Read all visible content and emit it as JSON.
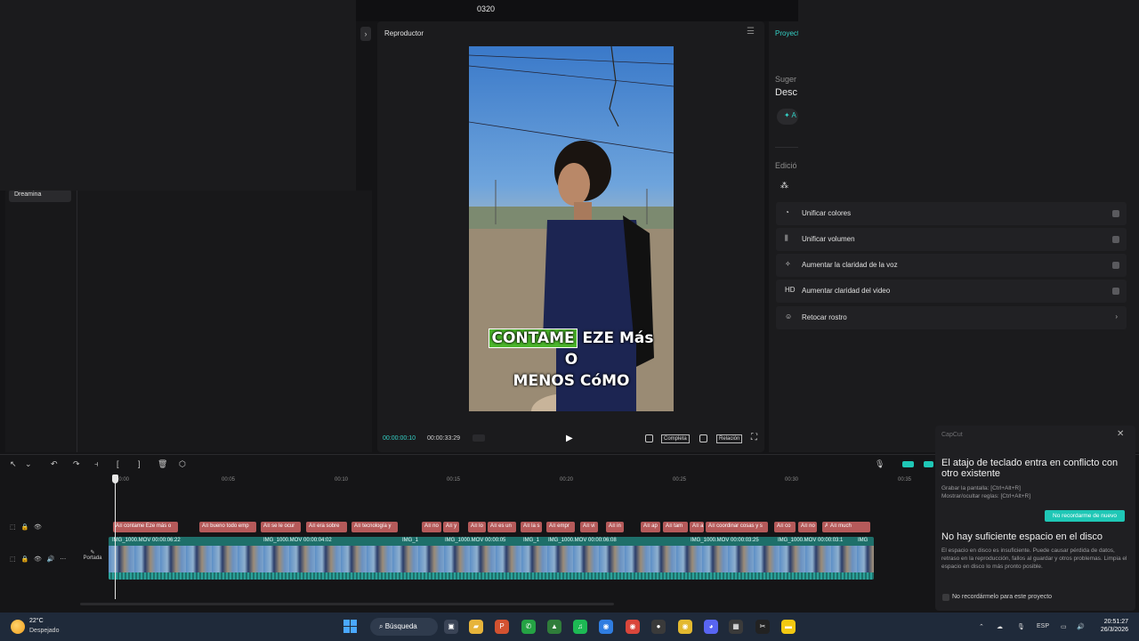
{
  "window": {
    "title": "0320"
  },
  "media_panel": {
    "dreamina_label": "Dreamina",
    "collapse_icon": "›"
  },
  "player": {
    "title": "Reproductor",
    "menu_icon": "☰",
    "caption_highlight": "CONTAME",
    "caption_rest_line1": " EZE Más",
    "caption_line2": "O",
    "caption_line3": "MENOS CóMO",
    "time_current": "00:00:00:10",
    "time_total": "00:00:33:29",
    "play_icon": "▶",
    "full_label": "Completa",
    "ratio_label": "Relación",
    "fullscreen_icon": "⛶"
  },
  "right_panel": {
    "project_tab": "Proyect",
    "suggestions": "Suger",
    "desc": "Desc",
    "spark_btn": "✦ A",
    "edicion": "Edició",
    "items": [
      {
        "icon": "◔",
        "label": "Unificar colores",
        "kind": "toggle"
      },
      {
        "icon": "⫼",
        "label": "Unificar volumen",
        "kind": "toggle"
      },
      {
        "icon": "✧",
        "label": "Aumentar la claridad de la voz",
        "kind": "toggle"
      },
      {
        "icon": "HD",
        "label": "Aumentar claridad del video",
        "kind": "toggle"
      },
      {
        "icon": "☺",
        "label": "Retocar rostro",
        "kind": "chevron"
      }
    ]
  },
  "timeline": {
    "toolbar_icons": [
      "↖",
      "⌄",
      "↶",
      "↷",
      "⫞",
      "[",
      "]",
      "🗑",
      "⬡"
    ],
    "ruler_labels": [
      "00:00",
      "00:05",
      "00:10",
      "00:15",
      "00:20",
      "00:25",
      "00:30",
      "00:35"
    ],
    "portada_label": "Portada",
    "text_clips": [
      "A≡ contame Eze más o",
      "A≡ bueno todo emp",
      "A≡ se le ocur",
      "A≡ era sobre",
      "A≡ tecnología y",
      "A≡ no",
      "A≡ y",
      "A≡ lo",
      "A≡ es un",
      "A≡ la s",
      "A≡ empr",
      "A≡ vi",
      "A≡ in",
      "A≡ ap",
      "A≡ tam",
      "A≡ a",
      "A≡ coordinar cosas y s",
      "A≡ co",
      "A≡ no",
      "A≡ mu",
      "A≡ much"
    ],
    "video_clips": [
      "IMG_1000.MOV  00:00:06:22",
      "IMG_1000.MOV  00:00:04:02",
      "IMG_1",
      "IMG_1000.MOV  00:00:05",
      "IMG_1",
      "IMG_1000.MOV  00:00:06:08",
      "IMG_1000.MOV  00:00:03:25",
      "IMG_1000.MOV  00:00:03:1",
      "IMG"
    ]
  },
  "notifications": {
    "app": "CapCut",
    "close_icon": "✕",
    "n1_title": "El atajo de teclado entra en conflicto con otro existente",
    "n1_line1": "Grabar la pantalla: [Ctrl+Alt+R]",
    "n1_line2": "Mostrar/ocultar reglas: [Ctrl+Alt+R]",
    "n1_button": "No recordarme de nuevo",
    "n2_title": "No hay suficiente espacio en el disco",
    "n2_body": "El espacio en disco es insuficiente. Puede causar pérdida de datos, retraso en la reproducción, fallos al guardar y otros problemas. Limpia el espacio en disco lo más pronto posible.",
    "n2_checkbox": "No recordármelo para este proyecto"
  },
  "taskbar": {
    "temp": "22°C",
    "weather": "Despejado",
    "search": "Búsqueda",
    "lang": "ESP",
    "time": "20:51:27",
    "date": "26/3/2026",
    "apps": [
      {
        "name": "task-view",
        "glyph": "▣",
        "color": "#3a4456"
      },
      {
        "name": "file-explorer",
        "glyph": "▰",
        "color": "#e7b43a"
      },
      {
        "name": "powerpoint",
        "glyph": "P",
        "color": "#d35230"
      },
      {
        "name": "whatsapp",
        "glyph": "✆",
        "color": "#25a244"
      },
      {
        "name": "app-green",
        "glyph": "▲",
        "color": "#2f7d3a"
      },
      {
        "name": "spotify",
        "glyph": "♫",
        "color": "#1db954"
      },
      {
        "name": "chrome",
        "glyph": "◉",
        "color": "#2f7de1"
      },
      {
        "name": "chrome-2",
        "glyph": "◉",
        "color": "#d9463b"
      },
      {
        "name": "obs",
        "glyph": "●",
        "color": "#3a3a3a"
      },
      {
        "name": "chrome-3",
        "glyph": "◉",
        "color": "#e3b92f"
      },
      {
        "name": "discord",
        "glyph": "◕",
        "color": "#5865f2"
      },
      {
        "name": "calculator",
        "glyph": "▦",
        "color": "#3a3a3a"
      },
      {
        "name": "capcut",
        "glyph": "✂",
        "color": "#222"
      },
      {
        "name": "sticky-notes",
        "glyph": "▬",
        "color": "#f2c811"
      }
    ]
  }
}
